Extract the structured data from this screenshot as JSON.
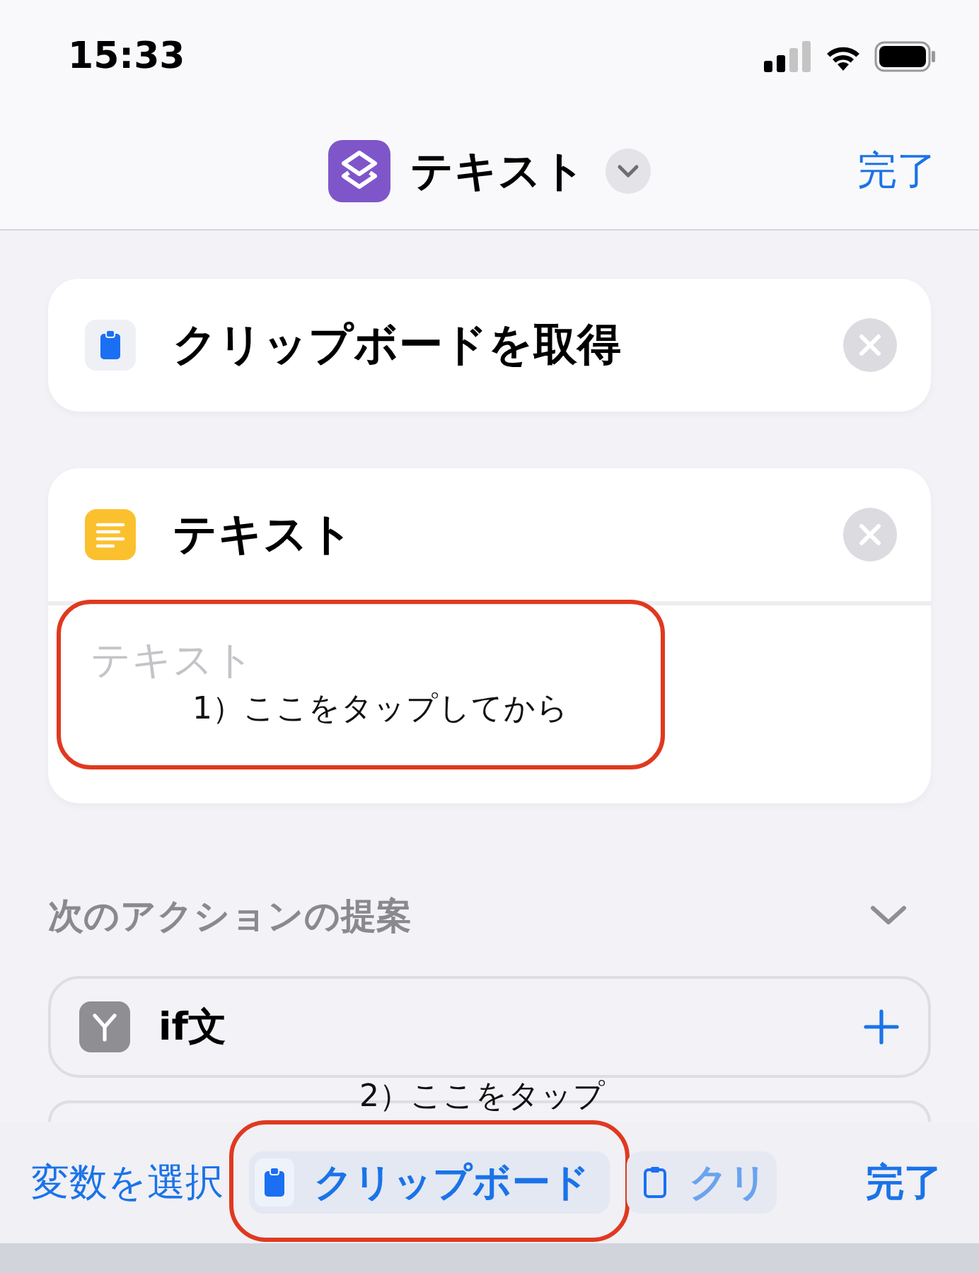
{
  "status_bar": {
    "time": "15:33"
  },
  "nav": {
    "title": "テキスト",
    "done": "完了"
  },
  "actions": [
    {
      "kind": "clipboard",
      "title": "クリップボードを取得"
    },
    {
      "kind": "text",
      "title": "テキスト",
      "placeholder": "テキスト"
    }
  ],
  "annotations": [
    {
      "text": "1）ここをタップしてから"
    },
    {
      "text": "2）ここをタップ"
    }
  ],
  "suggestions": {
    "heading": "次のアクションの提案",
    "expanded": true,
    "items": [
      {
        "kind": "if",
        "label": "if文"
      }
    ]
  },
  "toolbar": {
    "select_variable": "変数を選択",
    "chips": [
      {
        "label": "クリップボード",
        "selected": true
      },
      {
        "label": "クリ",
        "selected": false
      }
    ],
    "done": "完了"
  }
}
